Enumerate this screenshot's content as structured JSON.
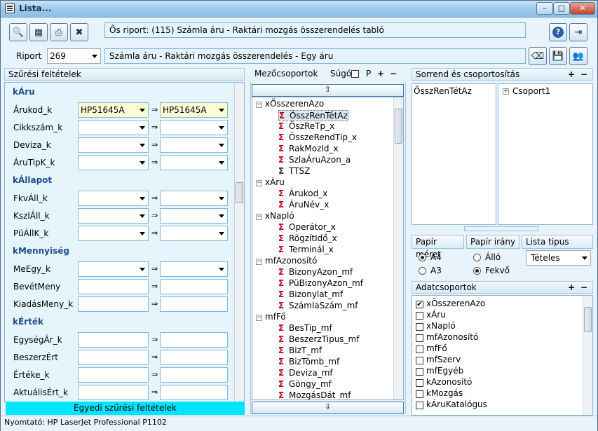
{
  "window": {
    "title": "Lista..."
  },
  "titlebar_buttons": {
    "minimize": "–",
    "maximize": "□",
    "close": "✕"
  },
  "top": {
    "source_report": "Ős riport: (115)  Számla áru - Raktári mozgás összerendelés tabló"
  },
  "report": {
    "label": "Riport",
    "number": "269",
    "name": "Számla áru - Raktári mozgás összerendelés - Egy áru"
  },
  "filters": {
    "header": "Szűrési feltételek",
    "arrow": "⇒",
    "footer_button": "Egyedi szűrési feltételek",
    "sections": [
      {
        "title": "kÁru",
        "rows": [
          {
            "label": "Árukod_k",
            "from": "HP51645A",
            "to": "HP51645A"
          },
          {
            "label": "Cikkszám_k",
            "from": "",
            "to": ""
          },
          {
            "label": "Deviza_k",
            "from": "",
            "to": ""
          },
          {
            "label": "ÁruTipK_k",
            "from": "",
            "to": ""
          }
        ]
      },
      {
        "title": "kÁllapot",
        "rows": [
          {
            "label": "FkvÁll_k",
            "from": "",
            "to": ""
          },
          {
            "label": "KszlÁll_k",
            "from": "",
            "to": ""
          },
          {
            "label": "PüÁllK_k",
            "from": "",
            "to": ""
          }
        ]
      },
      {
        "title": "kMennyiség",
        "rows": [
          {
            "label": "MeEgy_k",
            "from": "",
            "to": ""
          },
          {
            "label": "BevétMeny",
            "from": "",
            "to": ""
          },
          {
            "label": "KiadásMeny_k",
            "from": "",
            "to": ""
          }
        ]
      },
      {
        "title": "kÉrték",
        "rows": [
          {
            "label": "EgységÁr_k",
            "from": "",
            "to": ""
          },
          {
            "label": "BeszerzÉrt",
            "from": "",
            "to": ""
          },
          {
            "label": "Értéke_k",
            "from": "",
            "to": ""
          },
          {
            "label": "AktuálisÉrt_k",
            "from": "",
            "to": ""
          }
        ]
      }
    ]
  },
  "fields": {
    "header": "Mezőcsoportok",
    "help_label": "Súgó",
    "p_label": "P",
    "plus": "+",
    "minus": "−",
    "tree": [
      {
        "group": "xÖsszerenAzo",
        "items": [
          {
            "name": "ÖsszRenTétAz",
            "sigma": "red",
            "selected": true
          },
          {
            "name": "ÖszReTp_x",
            "sigma": "red"
          },
          {
            "name": "ÖsszeRendTip_x",
            "sigma": "red"
          },
          {
            "name": "RakMozId_x",
            "sigma": "red"
          },
          {
            "name": "SzlaÁruAzon_a",
            "sigma": "red"
          },
          {
            "name": "TTSZ",
            "sigma": "black"
          }
        ]
      },
      {
        "group": "xÁru",
        "items": [
          {
            "name": "Árukod_x",
            "sigma": "red"
          },
          {
            "name": "ÁruNév_x",
            "sigma": "red"
          }
        ]
      },
      {
        "group": "xNapló",
        "items": [
          {
            "name": "Operátor_x",
            "sigma": "red"
          },
          {
            "name": "RögzítIdő_x",
            "sigma": "red"
          },
          {
            "name": "Terminál_x",
            "sigma": "red"
          }
        ]
      },
      {
        "group": "mfAzonosító",
        "items": [
          {
            "name": "BizonyAzon_mf",
            "sigma": "red"
          },
          {
            "name": "PüBizonyAzon_mf",
            "sigma": "red"
          },
          {
            "name": "Bizonylat_mf",
            "sigma": "red"
          },
          {
            "name": "SzámlaSzám_mf",
            "sigma": "red"
          }
        ]
      },
      {
        "group": "mfFő",
        "items": [
          {
            "name": "BesTip_mf",
            "sigma": "red"
          },
          {
            "name": "BeszerzTipus_mf",
            "sigma": "red"
          },
          {
            "name": "BizT_mf",
            "sigma": "red"
          },
          {
            "name": "BizTömb_mf",
            "sigma": "red"
          },
          {
            "name": "Deviza_mf",
            "sigma": "red"
          },
          {
            "name": "Göngy_mf",
            "sigma": "red"
          },
          {
            "name": "MozgásDát_mf",
            "sigma": "red"
          }
        ]
      }
    ]
  },
  "order": {
    "header": "Sorrend és csoportosítás",
    "plus": "+",
    "minus": "−",
    "left_items": [
      "ÖsszRenTétAz"
    ],
    "right_items": [
      {
        "name": "Csoport1"
      }
    ]
  },
  "paper": {
    "size_label": "Papír méret",
    "orientation_label": "Papír irány",
    "list_type_label": "Lista tipus",
    "a4": "A4",
    "a3": "A3",
    "portrait": "Álló",
    "landscape": "Fekvő",
    "list_type_value": "Tételes"
  },
  "datagroups": {
    "header": "Adatcsoportok",
    "plus": "+",
    "minus": "−",
    "items": [
      {
        "name": "xÖsszerenAzo",
        "checked": true
      },
      {
        "name": "xÁru",
        "checked": false
      },
      {
        "name": "xNapló",
        "checked": false
      },
      {
        "name": "mfAzonosító",
        "checked": false
      },
      {
        "name": "mfFő",
        "checked": false
      },
      {
        "name": "mfSzerv",
        "checked": false
      },
      {
        "name": "mfEgyéb",
        "checked": false
      },
      {
        "name": "kAzonosító",
        "checked": false
      },
      {
        "name": "kMozgás",
        "checked": false
      },
      {
        "name": "kÁruKatalógus",
        "checked": false
      }
    ]
  },
  "status": {
    "printer": "Nyomtató: HP LaserJet Professional P1102"
  }
}
